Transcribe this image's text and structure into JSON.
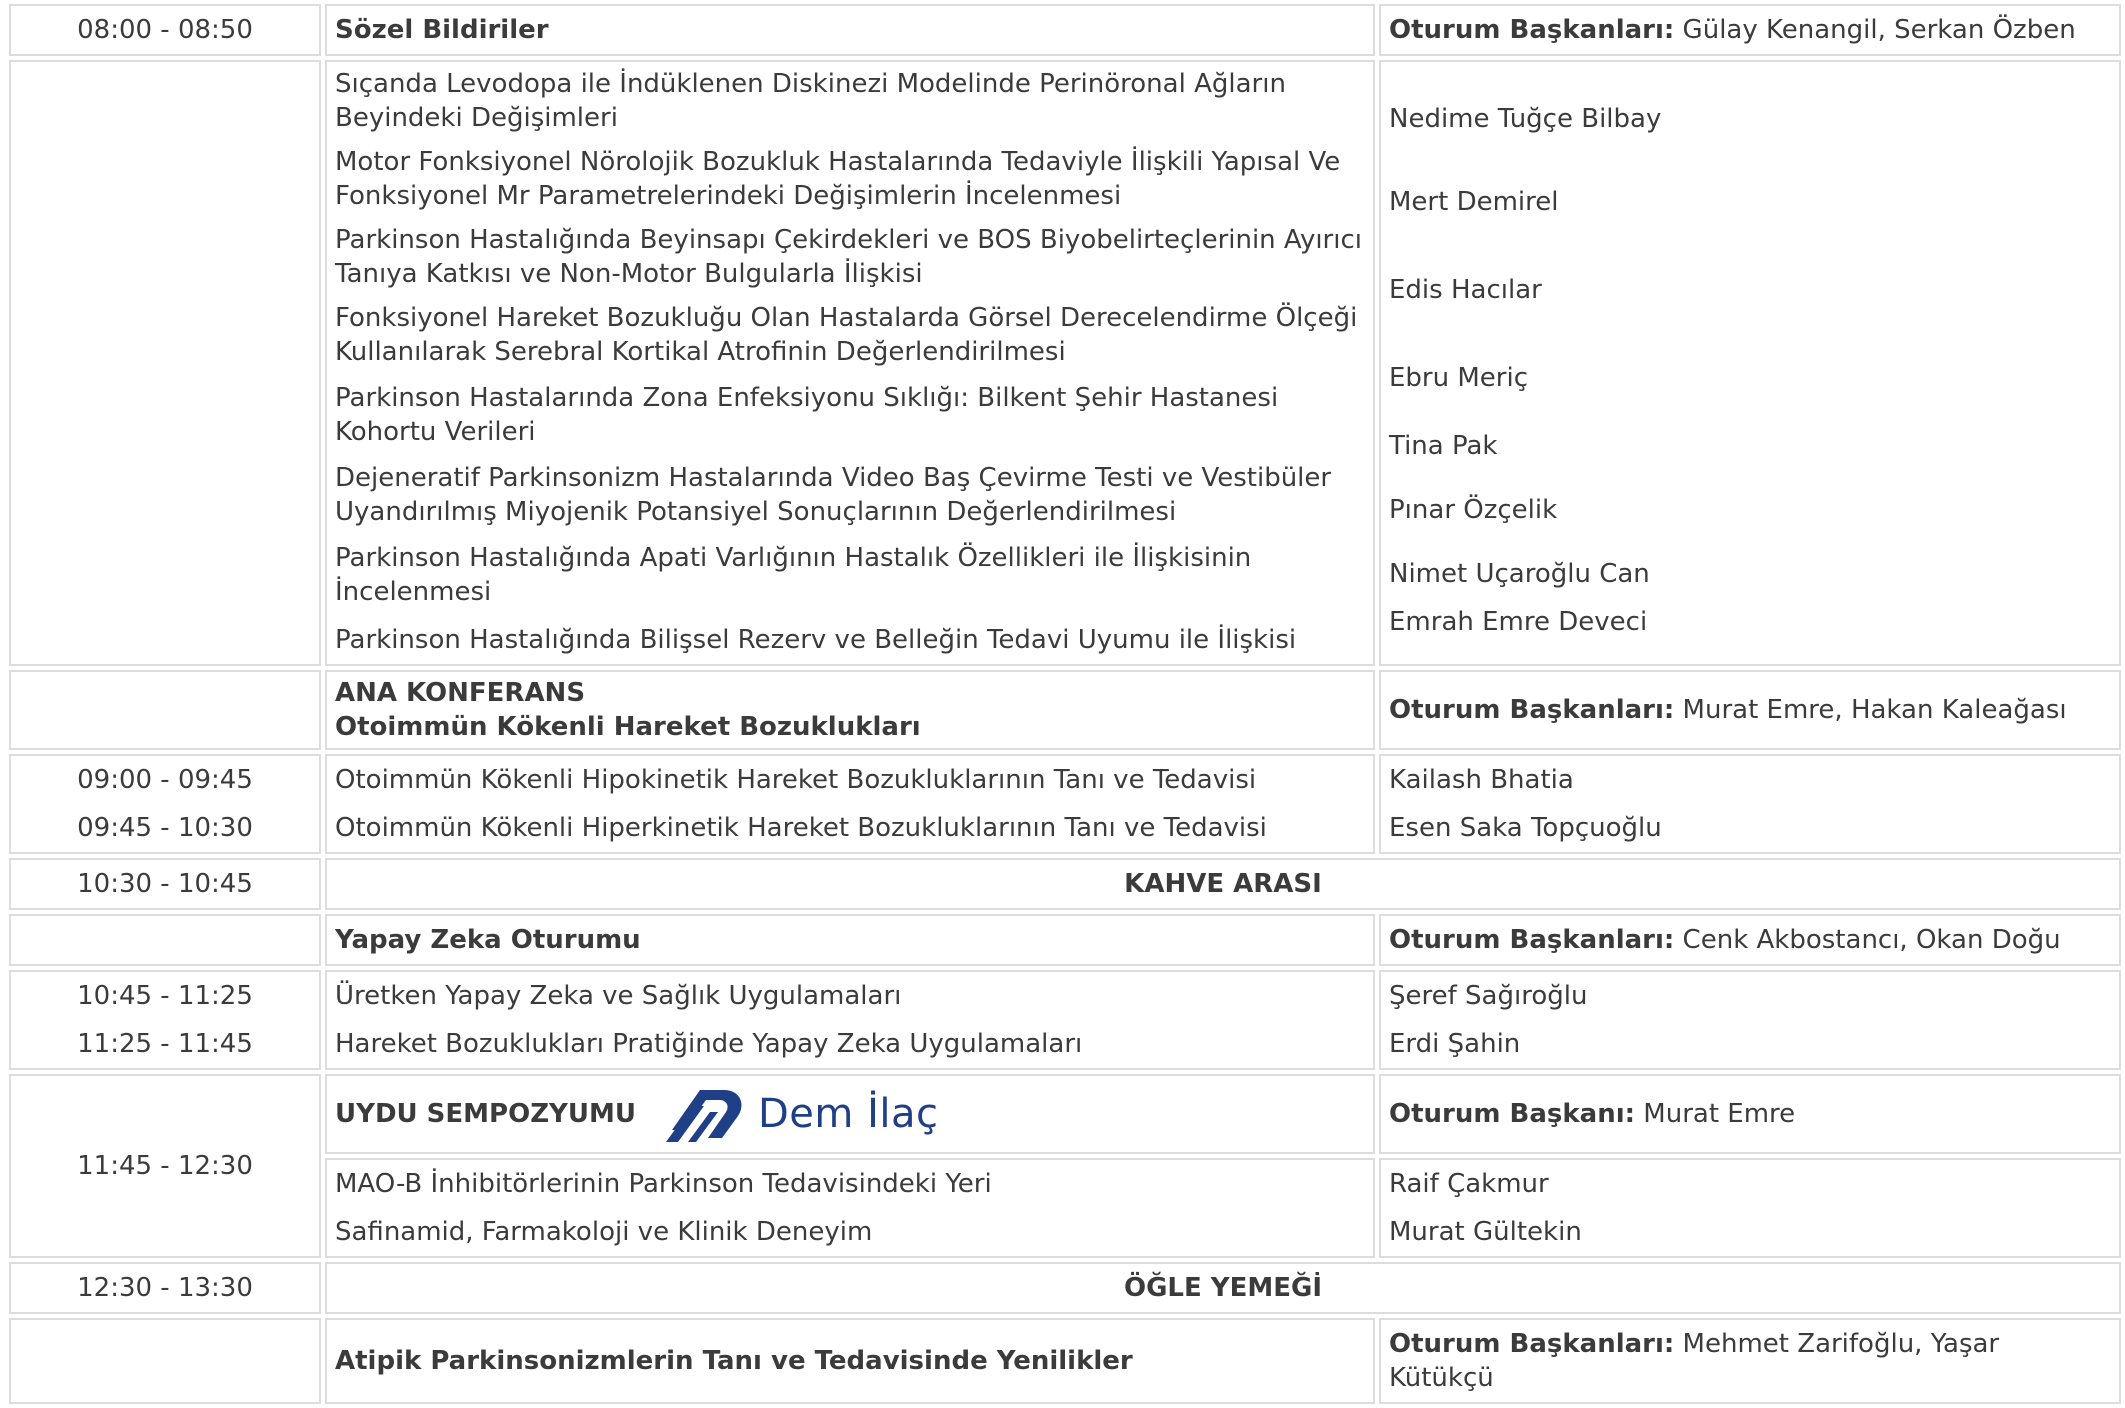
{
  "colors": {
    "coffee_break_bg": "#fef7c6",
    "lunch_break_bg": "#d5cbe7",
    "border": "#dcdcdc",
    "text": "#3b3b3b",
    "logo_blue": "#1f3f86"
  },
  "session1": {
    "time": "08:00 - 08:50",
    "title": "Sözel Bildiriler",
    "chair_label": "Oturum Başkanları:",
    "chair_names": " Gülay Kenangil, Serkan Özben",
    "talks": [
      {
        "title": "Sıçanda Levodopa ile İndüklenen Diskinezi Modelinde Perinöronal Ağların Beyindeki Değişimleri",
        "speaker": "Nedime Tuğçe Bilbay"
      },
      {
        "title": "Motor Fonksiyonel Nörolojik Bozukluk Hastalarında Tedaviyle İlişkili Yapısal Ve Fonksiyonel Mr Parametrelerindeki Değişimlerin İncelenmesi",
        "speaker": "Mert Demirel"
      },
      {
        "title": "Parkinson Hastalığında Beyinsapı Çekirdekleri ve BOS Biyobelirteçlerinin Ayırıcı Tanıya Katkısı ve Non-Motor Bulgularla İlişkisi",
        "speaker": "Edis Hacılar"
      },
      {
        "title": "Fonksiyonel Hareket Bozukluğu Olan Hastalarda Görsel Derecelendirme Ölçeği Kullanılarak Serebral Kortikal Atrofinin Değerlendirilmesi",
        "speaker": "Ebru Meriç"
      },
      {
        "title": "Parkinson Hastalarında Zona Enfeksiyonu Sıklığı: Bilkent Şehir Hastanesi Kohortu Verileri",
        "speaker": "Tina Pak"
      },
      {
        "title": "Dejeneratif Parkinsonizm Hastalarında Video Baş Çevirme Testi ve Vestibüler Uyandırılmış Miyojenik Potansiyel Sonuçlarının Değerlendirilmesi",
        "speaker": "Pınar Özçelik"
      },
      {
        "title": "Parkinson Hastalığında Apati Varlığının Hastalık Özellikleri ile İlişkisinin İncelenmesi",
        "speaker": "Nimet Uçaroğlu Can"
      },
      {
        "title": "Parkinson Hastalığında Bilişsel Rezerv ve Belleğin Tedavi Uyumu ile İlişkisi",
        "speaker": "Emrah Emre Deveci"
      }
    ]
  },
  "session2": {
    "title_line1": "ANA KONFERANS",
    "title_line2": "Otoimmün Kökenli Hareket Bozuklukları",
    "chair_label": "Oturum Başkanları:",
    "chair_names": " Murat Emre, Hakan Kaleağası",
    "talks": [
      {
        "time": "09:00 - 09:45",
        "title": "Otoimmün Kökenli Hipokinetik Hareket Bozukluklarının Tanı ve Tedavisi",
        "speaker": "Kailash Bhatia"
      },
      {
        "time": "09:45 - 10:30",
        "title": "Otoimmün Kökenli Hiperkinetik Hareket Bozukluklarının Tanı ve Tedavisi",
        "speaker": "Esen Saka Topçuoğlu"
      }
    ]
  },
  "coffee_break": {
    "time": "10:30 - 10:45",
    "label": "KAHVE ARASI"
  },
  "session3": {
    "title": "Yapay Zeka Oturumu",
    "chair_label": "Oturum Başkanları:",
    "chair_names": " Cenk Akbostancı, Okan Doğu",
    "talks": [
      {
        "time": "10:45 - 11:25",
        "title": "Üretken Yapay Zeka ve Sağlık Uygulamaları",
        "speaker": "Şeref Sağıroğlu"
      },
      {
        "time": "11:25 - 11:45",
        "title": "Hareket Bozuklukları Pratiğinde Yapay Zeka Uygulamaları",
        "speaker": "Erdi Şahin"
      }
    ]
  },
  "session4": {
    "time": "11:45 - 12:30",
    "title": "UYDU SEMPOZYUMU",
    "sponsor_logo_text": "Dem İlaç",
    "sponsor_icon": "dem-ilac-logo-icon",
    "chair_label": "Oturum Başkanı:",
    "chair_names": " Murat Emre",
    "talks": [
      {
        "title": "MAO-B İnhibitörlerinin Parkinson Tedavisindeki Yeri",
        "speaker": "Raif Çakmur"
      },
      {
        "title": "Safinamid, Farmakoloji ve Klinik Deneyim",
        "speaker": "Murat Gültekin"
      }
    ]
  },
  "lunch_break": {
    "time": "12:30 - 13:30",
    "label": "ÖĞLE YEMEĞİ"
  },
  "session5": {
    "title": "Atipik Parkinsonizmlerin Tanı ve Tedavisinde Yenilikler",
    "chair_label": "Oturum Başkanları:",
    "chair_names": " Mehmet Zarifoğlu, Yaşar Kütükçü"
  }
}
